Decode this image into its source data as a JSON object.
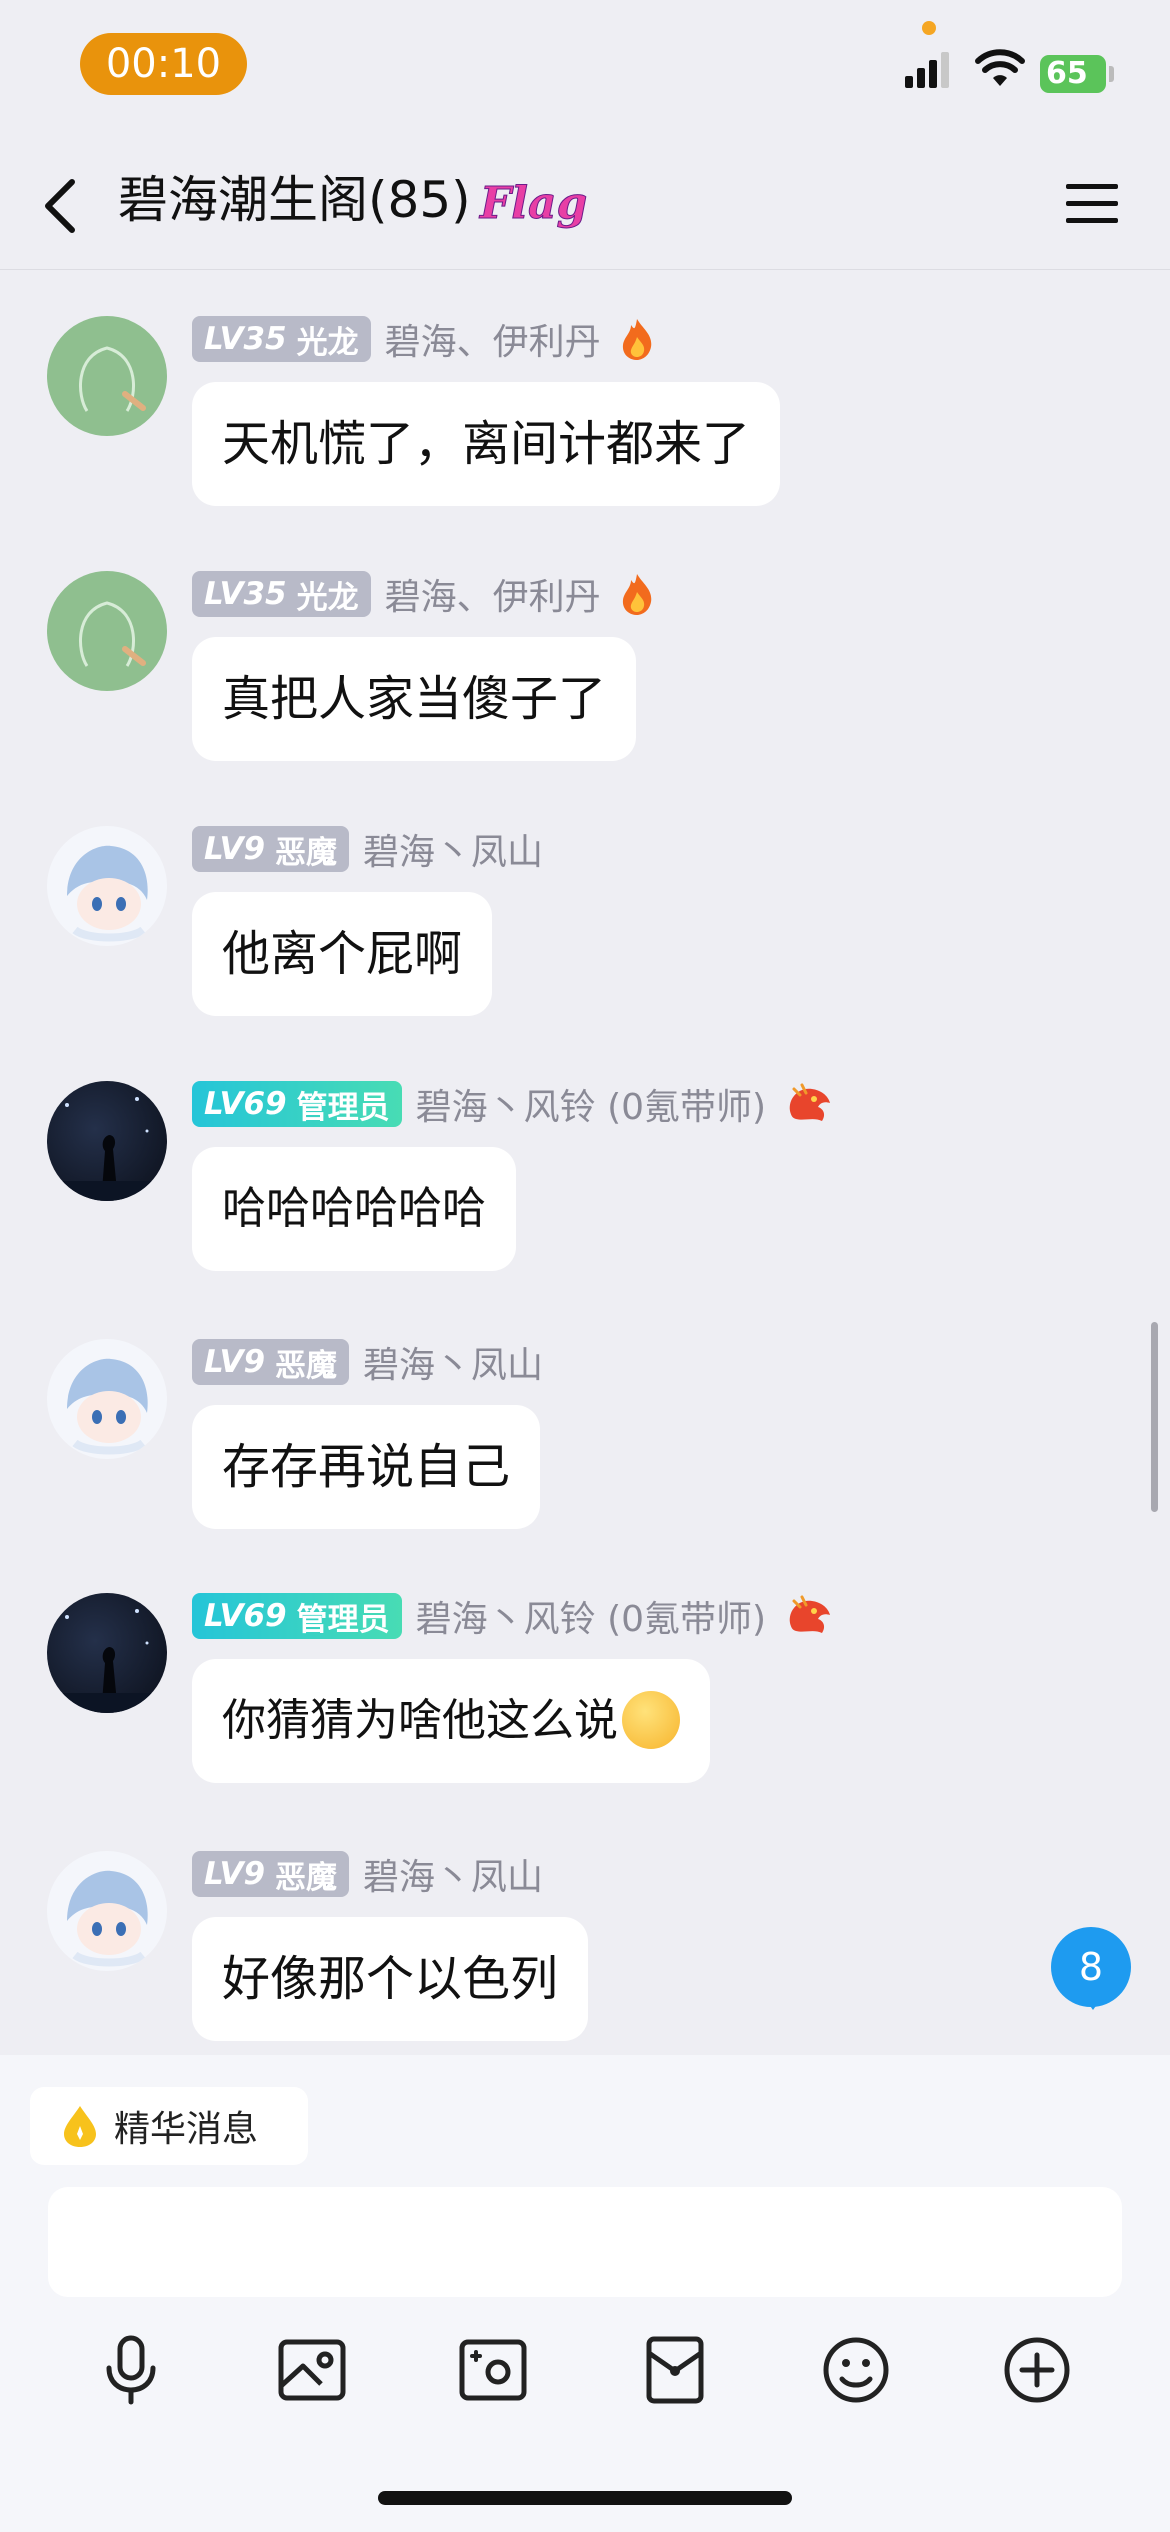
{
  "status_bar": {
    "time": "00:10",
    "battery": "65"
  },
  "header": {
    "title": "碧海潮生阁(85)",
    "badge": "Flag"
  },
  "messages": [
    {
      "lv": "LV35",
      "role": "光龙",
      "sender": "碧海、伊利丹",
      "text": "天机慌了，离间计都来了"
    },
    {
      "lv": "LV35",
      "role": "光龙",
      "sender": "碧海、伊利丹",
      "text": "真把人家当傻子了"
    },
    {
      "lv": "LV9",
      "role": "恶魔",
      "sender": "碧海丶凤山",
      "text": "他离个屁啊"
    },
    {
      "lv": "LV69",
      "role": "管理员",
      "sender": "碧海丶风铃 (0氪带师)",
      "text": "哈哈哈哈哈哈"
    },
    {
      "lv": "LV9",
      "role": "恶魔",
      "sender": "碧海丶凤山",
      "text": "存存再说自己"
    },
    {
      "lv": "LV69",
      "role": "管理员",
      "sender": "碧海丶风铃 (0氪带师)",
      "text": "你猜猜为啥他这么说"
    },
    {
      "lv": "LV9",
      "role": "恶魔",
      "sender": "碧海丶凤山",
      "text": "好像那个以色列"
    }
  ],
  "unread_count": "8",
  "essence": {
    "label": "精华消息"
  },
  "colors": {
    "accent": "#1e9bf0",
    "time_pill": "#e9930c",
    "admin_badge": "#25c5d8",
    "level_badge": "#b8bac8"
  },
  "toolbar_icons": [
    "microphone-icon",
    "image-icon",
    "camera-icon",
    "red-packet-icon",
    "emoji-icon",
    "plus-icon"
  ]
}
